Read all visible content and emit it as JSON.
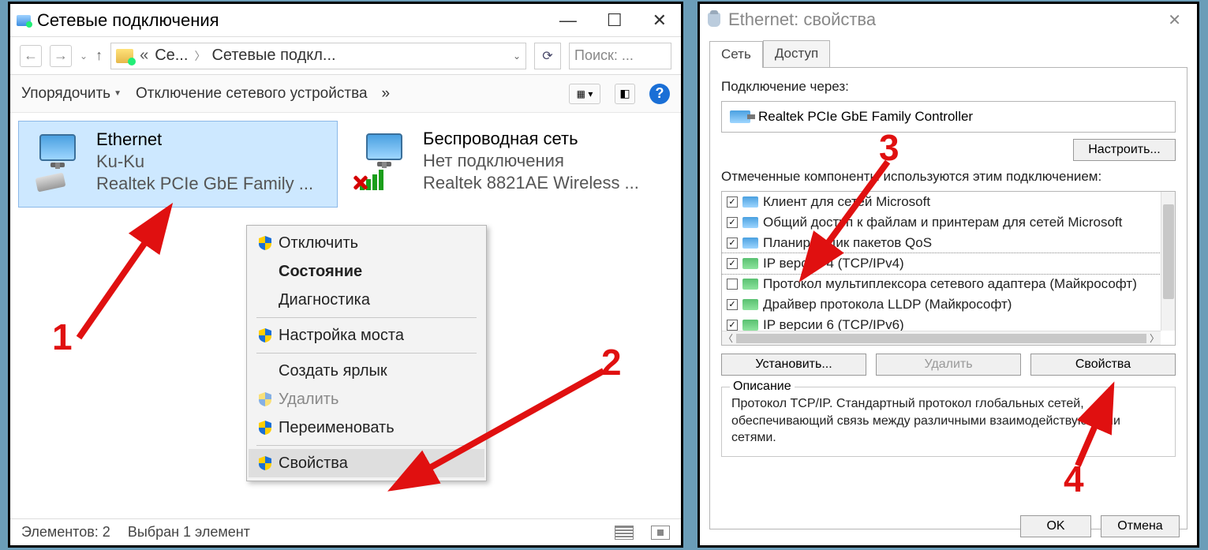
{
  "window1": {
    "title": "Сетевые подключения",
    "nav": {
      "crumb1": "Се...",
      "crumb2": "Сетевые подкл...",
      "search_placeholder": "Поиск: ..."
    },
    "toolbar": {
      "organize": "Упорядочить",
      "disable": "Отключение сетевого устройства",
      "more": "»"
    },
    "connections": [
      {
        "name": "Ethernet",
        "network": "Ku-Ku",
        "adapter": "Realtek PCIe GbE Family ..."
      },
      {
        "name": "Беспроводная сеть",
        "network": "Нет подключения",
        "adapter": "Realtek 8821AE Wireless ..."
      }
    ],
    "context_menu": {
      "disable": "Отключить",
      "status": "Состояние",
      "diagnose": "Диагностика",
      "bridge": "Настройка моста",
      "shortcut": "Создать ярлык",
      "delete": "Удалить",
      "rename": "Переименовать",
      "properties": "Свойства"
    },
    "statusbar": {
      "items": "Элементов: 2",
      "selected": "Выбран 1 элемент"
    }
  },
  "window2": {
    "title": "Ethernet: свойства",
    "tabs": {
      "network": "Сеть",
      "sharing": "Доступ"
    },
    "connect_via_label": "Подключение через:",
    "adapter": "Realtek PCIe GbE Family Controller",
    "configure_btn": "Настроить...",
    "components_label": "Отмеченные компоненты используются этим подключением:",
    "components": [
      {
        "checked": true,
        "icon": "pc",
        "label": "Клиент для сетей Microsoft"
      },
      {
        "checked": true,
        "icon": "pc",
        "label": "Общий доступ к файлам и принтерам для сетей Microsoft"
      },
      {
        "checked": true,
        "icon": "pc",
        "label": "Планировщик пакетов QoS"
      },
      {
        "checked": true,
        "icon": "net",
        "label": "IP версии 4 (TCP/IPv4)",
        "selected": true
      },
      {
        "checked": false,
        "icon": "net",
        "label": "Протокол мультиплексора сетевого адаптера (Майкрософт)"
      },
      {
        "checked": true,
        "icon": "net",
        "label": "Драйвер протокола LLDP (Майкрософт)"
      },
      {
        "checked": true,
        "icon": "net",
        "label": "IP версии 6 (TCP/IPv6)"
      }
    ],
    "install_btn": "Установить...",
    "uninstall_btn": "Удалить",
    "properties_btn": "Свойства",
    "description_title": "Описание",
    "description_text": "Протокол TCP/IP. Стандартный протокол глобальных сетей, обеспечивающий связь между различными взаимодействующими сетями.",
    "ok_btn": "OK",
    "cancel_btn": "Отмена"
  },
  "annotations": {
    "n1": "1",
    "n2": "2",
    "n3": "3",
    "n4": "4"
  }
}
